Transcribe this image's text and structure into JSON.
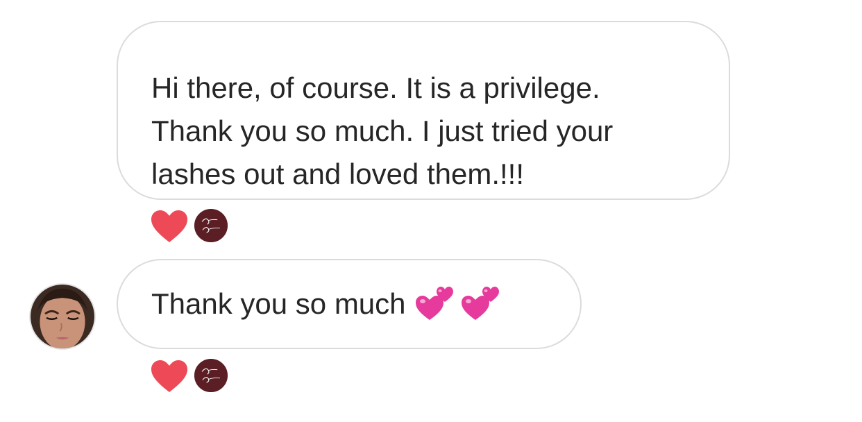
{
  "conversation": {
    "messages": [
      {
        "lines": [
          "Hi there, of course. It is a privilege.",
          "Thank you so much. I just tried your",
          "lashes out and loved them.!!!"
        ],
        "reactions": [
          "heart-icon",
          "luma-lashes-avatar"
        ]
      },
      {
        "text": "Thank you so much",
        "emojis": [
          "two-hearts-emoji",
          "two-hearts-emoji"
        ],
        "reactions": [
          "heart-icon",
          "luma-lashes-avatar"
        ]
      }
    ],
    "reaction_avatar": {
      "logo_line_1": "Luma",
      "logo_line_2": "Lashes"
    }
  },
  "colors": {
    "bubble_border": "#dbdbdb",
    "text": "#262626",
    "heart_red": "#ed4956",
    "emoji_pink": "#e63b9c",
    "brand_maroon": "#5a1e24"
  }
}
